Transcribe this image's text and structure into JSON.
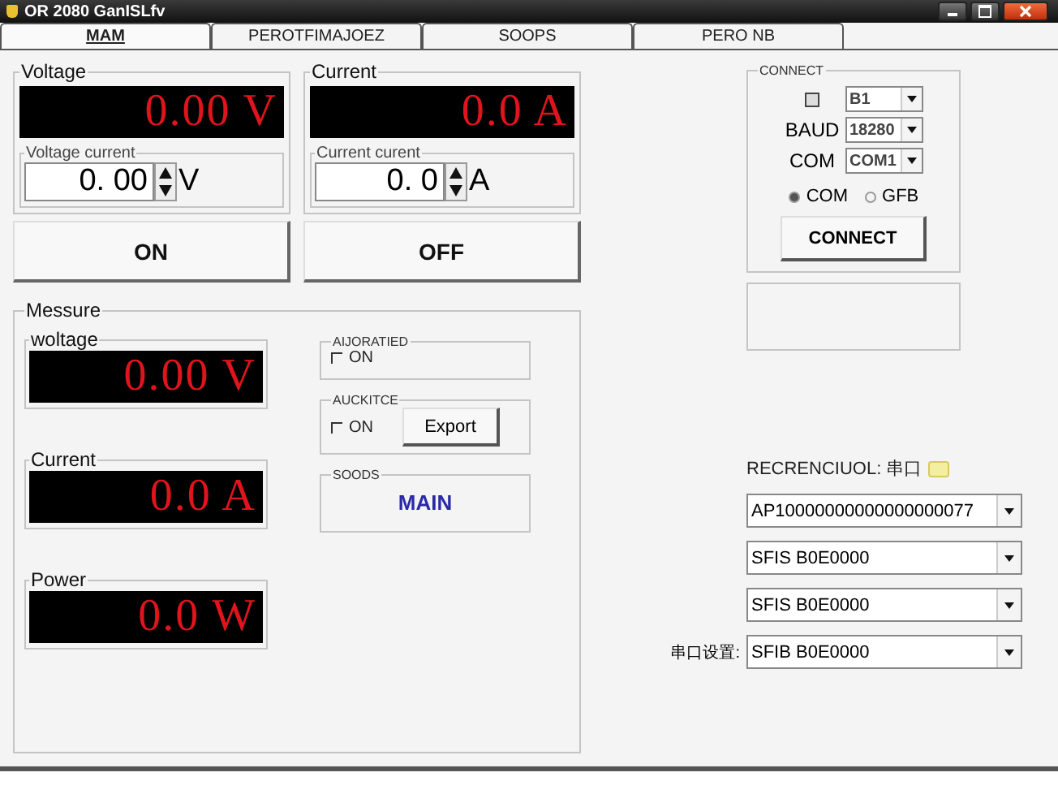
{
  "window": {
    "title": "OR 2080 GanISLfv"
  },
  "tabs": [
    {
      "label": "MAM",
      "selected": true
    },
    {
      "label": "PEROTFIMAJOEZ",
      "selected": false
    },
    {
      "label": "SOOPS",
      "selected": false
    },
    {
      "label": "PERO NB",
      "selected": false
    }
  ],
  "outputs": [
    {
      "legend": "Voltage",
      "display": "0.00 V",
      "setting_legend": "Voltage current",
      "setting_value": "0. 00",
      "unit": "V"
    },
    {
      "legend": "Current",
      "display": "0.0 A",
      "setting_legend": "Current curent",
      "setting_value": "0. 0",
      "unit": "A"
    }
  ],
  "buttons": [
    "ON",
    "OFF"
  ],
  "measure": {
    "legend": "Messure",
    "meters": [
      {
        "label": "woltage",
        "display": "0.00 V"
      },
      {
        "label": "Current",
        "display": "0.0 A"
      },
      {
        "label": "Power",
        "display": "0.0 W"
      }
    ],
    "options": [
      {
        "kind": "checkbox",
        "legend": "AIJORATIED",
        "label": "ON",
        "checked": false
      },
      {
        "kind": "checkbox-button",
        "legend": "AUCKITCE",
        "label": "ON",
        "checked": false,
        "button": "Export"
      },
      {
        "kind": "status",
        "legend": "SOODS",
        "value": "MAIN"
      }
    ]
  },
  "connect": {
    "legend": "CONNECT",
    "rows": [
      {
        "kind": "checkbox",
        "checked": false,
        "value": "B1"
      },
      {
        "kind": "label",
        "label": "BAUD",
        "value": "18280"
      },
      {
        "kind": "label",
        "label": "COM",
        "value": "COM1"
      }
    ],
    "radios": [
      {
        "label": "COM",
        "selected": true
      },
      {
        "label": "GFB",
        "selected": false
      }
    ],
    "button": "CONNECT"
  },
  "recorder": {
    "label": "RECRENCIUOL: 串口",
    "selects": [
      {
        "value": "AP10000000000000000077"
      },
      {
        "value": "SFIS B0E0000"
      },
      {
        "value": "SFIS B0E0000"
      },
      {
        "label": "串口设置:",
        "value": "SFIB B0E0000"
      }
    ]
  }
}
